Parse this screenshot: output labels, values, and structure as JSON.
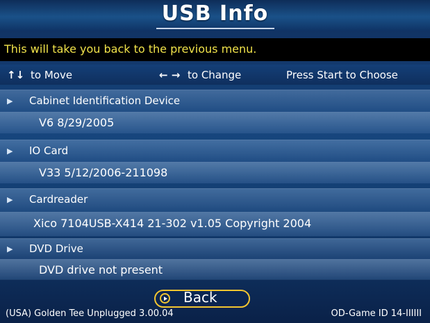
{
  "header": {
    "title": "USB Info"
  },
  "description": "This will take you back to the previous menu.",
  "help": {
    "move_icon": "↑↓",
    "move_text": "to Move",
    "change_icon": "← →",
    "change_text": "to Change",
    "choose_text": "Press Start to Choose"
  },
  "items": [
    {
      "label": "Cabinet Identification Device",
      "value": "V6 8/29/2005"
    },
    {
      "label": "IO Card",
      "value": "V33 5/12/2006-211098"
    },
    {
      "label": "Cardreader",
      "value": "Xico 7104USB-X414 21-302 v1.05 Copyright 2004"
    },
    {
      "label": "DVD Drive",
      "value": "DVD drive not present"
    }
  ],
  "back_button": {
    "label": "Back",
    "icon": "play-circle-icon"
  },
  "footer": {
    "left": "(USA) Golden Tee Unplugged 3.00.04",
    "right": "OD-Game ID 14-IIIIII"
  },
  "colors": {
    "title_text": "#ffffff",
    "description_text": "#f0e24a",
    "button_border": "#f2c530",
    "background": "#17467e"
  }
}
